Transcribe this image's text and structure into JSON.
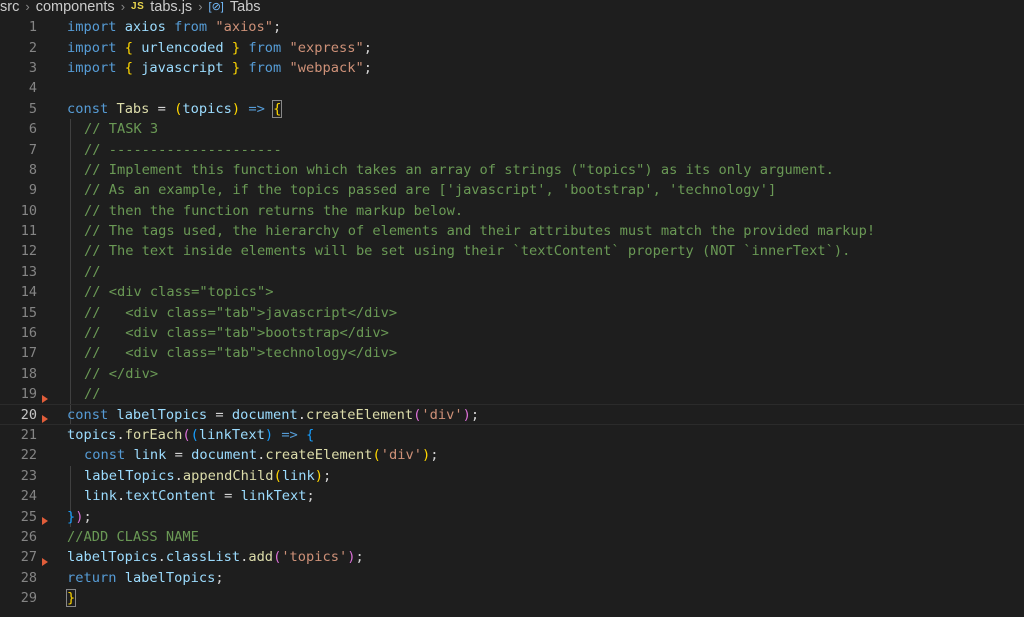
{
  "breadcrumb": {
    "items": [
      "src",
      "components",
      "tabs.js",
      "Tabs"
    ],
    "file_badge": "JS",
    "symbol_icon": "[⊘]"
  },
  "editor": {
    "active_line": 20,
    "lines": [
      {
        "n": "1"
      },
      {
        "n": "2"
      },
      {
        "n": "3"
      },
      {
        "n": "4"
      },
      {
        "n": "5"
      },
      {
        "n": "6"
      },
      {
        "n": "7"
      },
      {
        "n": "8"
      },
      {
        "n": "9"
      },
      {
        "n": "10"
      },
      {
        "n": "11"
      },
      {
        "n": "12"
      },
      {
        "n": "13"
      },
      {
        "n": "14"
      },
      {
        "n": "15"
      },
      {
        "n": "16"
      },
      {
        "n": "17"
      },
      {
        "n": "18"
      },
      {
        "n": "19"
      },
      {
        "n": "20"
      },
      {
        "n": "21"
      },
      {
        "n": "22"
      },
      {
        "n": "23"
      },
      {
        "n": "24"
      },
      {
        "n": "25"
      },
      {
        "n": "26"
      },
      {
        "n": "27"
      },
      {
        "n": "28"
      },
      {
        "n": "29"
      }
    ],
    "code": {
      "l1": [
        "import",
        " axios ",
        "from",
        " \"axios\"",
        ";"
      ],
      "l2": [
        "import",
        " { ",
        "urlencoded",
        " } ",
        "from",
        " \"express\"",
        ";"
      ],
      "l3": [
        "import",
        " { ",
        "javascript",
        " } ",
        "from",
        " \"webpack\"",
        ";"
      ],
      "l5": [
        "const",
        " ",
        "Tabs",
        " = ",
        "(",
        "topics",
        ")",
        " => ",
        "{"
      ],
      "l6": "// TASK 3",
      "l7": "// ---------------------",
      "l8": "// Implement this function which takes an array of strings (\"topics\") as its only argument.",
      "l9": "// As an example, if the topics passed are ['javascript', 'bootstrap', 'technology']",
      "l10": "// then the function returns the markup below.",
      "l11": "// The tags used, the hierarchy of elements and their attributes must match the provided markup!",
      "l12": "// The text inside elements will be set using their `textContent` property (NOT `innerText`).",
      "l13": "//",
      "l14": "// <div class=\"topics\">",
      "l15": "//   <div class=\"tab\">javascript</div>",
      "l16": "//   <div class=\"tab\">bootstrap</div>",
      "l17": "//   <div class=\"tab\">technology</div>",
      "l18": "// </div>",
      "l19": "//",
      "l20": [
        "const",
        " ",
        "labelTopics",
        " = ",
        "document",
        ".",
        "createElement",
        "(",
        "'div'",
        ")",
        ";"
      ],
      "l21": [
        "topics",
        ".",
        "forEach",
        "(",
        "(",
        "linkText",
        ")",
        " => ",
        "{"
      ],
      "l22": [
        "const",
        " ",
        "link",
        " = ",
        "document",
        ".",
        "createElement",
        "(",
        "'div'",
        ")",
        ";"
      ],
      "l23": [
        "labelTopics",
        ".",
        "appendChild",
        "(",
        "link",
        ")",
        ";"
      ],
      "l24": [
        "link",
        ".",
        "textContent",
        " = ",
        "linkText",
        ";"
      ],
      "l25": [
        "}",
        ")",
        ";"
      ],
      "l26": "//ADD CLASS NAME",
      "l27": [
        "labelTopics",
        ".",
        "classList",
        ".",
        "add",
        "(",
        "'topics'",
        ")",
        ";"
      ],
      "l28": [
        "return",
        " ",
        "labelTopics",
        ";"
      ],
      "l29": [
        "}"
      ]
    }
  }
}
